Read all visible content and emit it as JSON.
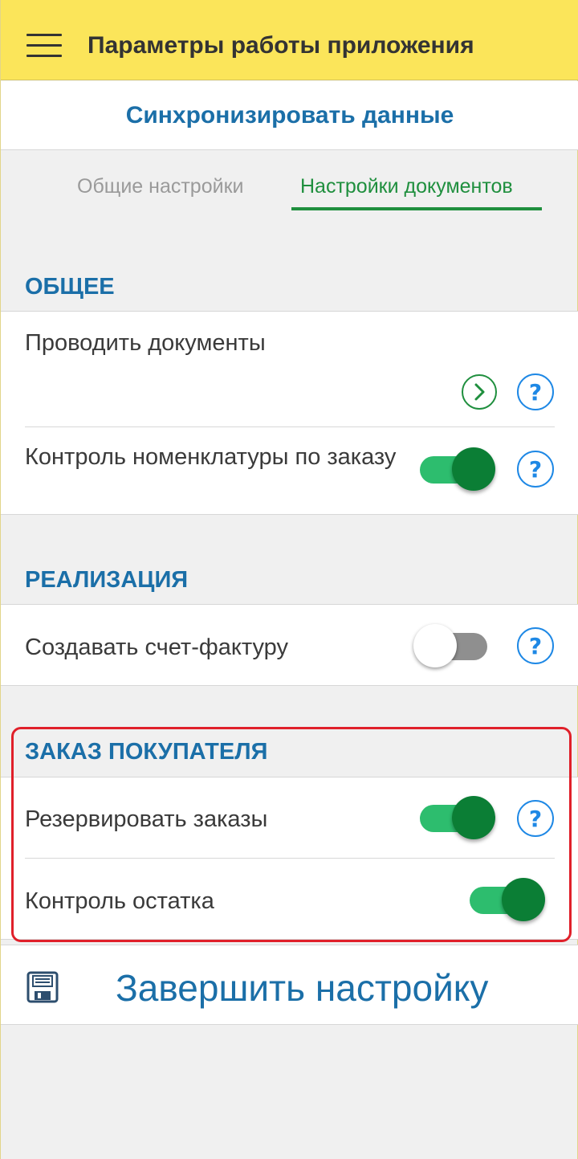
{
  "app_bar": {
    "title": "Параметры работы приложения",
    "menu_icon": "hamburger-menu-icon",
    "background": "#fbe55a"
  },
  "sync": {
    "label": "Синхронизировать данные"
  },
  "tabs": [
    {
      "label": "Общие настройки",
      "active": false
    },
    {
      "label": "Настройки документов",
      "active": true
    }
  ],
  "sections": {
    "general": {
      "title": "ОБЩЕЕ",
      "post_documents": {
        "label": "Проводить документы"
      },
      "nomenclature_control": {
        "label": "Контроль номенклатуры по заказу",
        "enabled": true
      }
    },
    "realization": {
      "title": "РЕАЛИЗАЦИЯ",
      "create_invoice": {
        "label": "Создавать счет-фактуру",
        "enabled": false
      }
    },
    "customer_order": {
      "title": "ЗАКАЗ ПОКУПАТЕЛЯ",
      "reserve_orders": {
        "label": "Резервировать заказы",
        "enabled": true
      },
      "stock_control": {
        "label": "Контроль остатка",
        "enabled": true
      }
    }
  },
  "finish": {
    "label": "Завершить настройку",
    "icon": "floppy-disk-icon"
  },
  "help_symbol": "?",
  "colors": {
    "accent_blue": "#1b6fa8",
    "accent_green": "#1f8f3e",
    "toggle_on": "#2dbd6e",
    "highlight": "#e0202a"
  }
}
